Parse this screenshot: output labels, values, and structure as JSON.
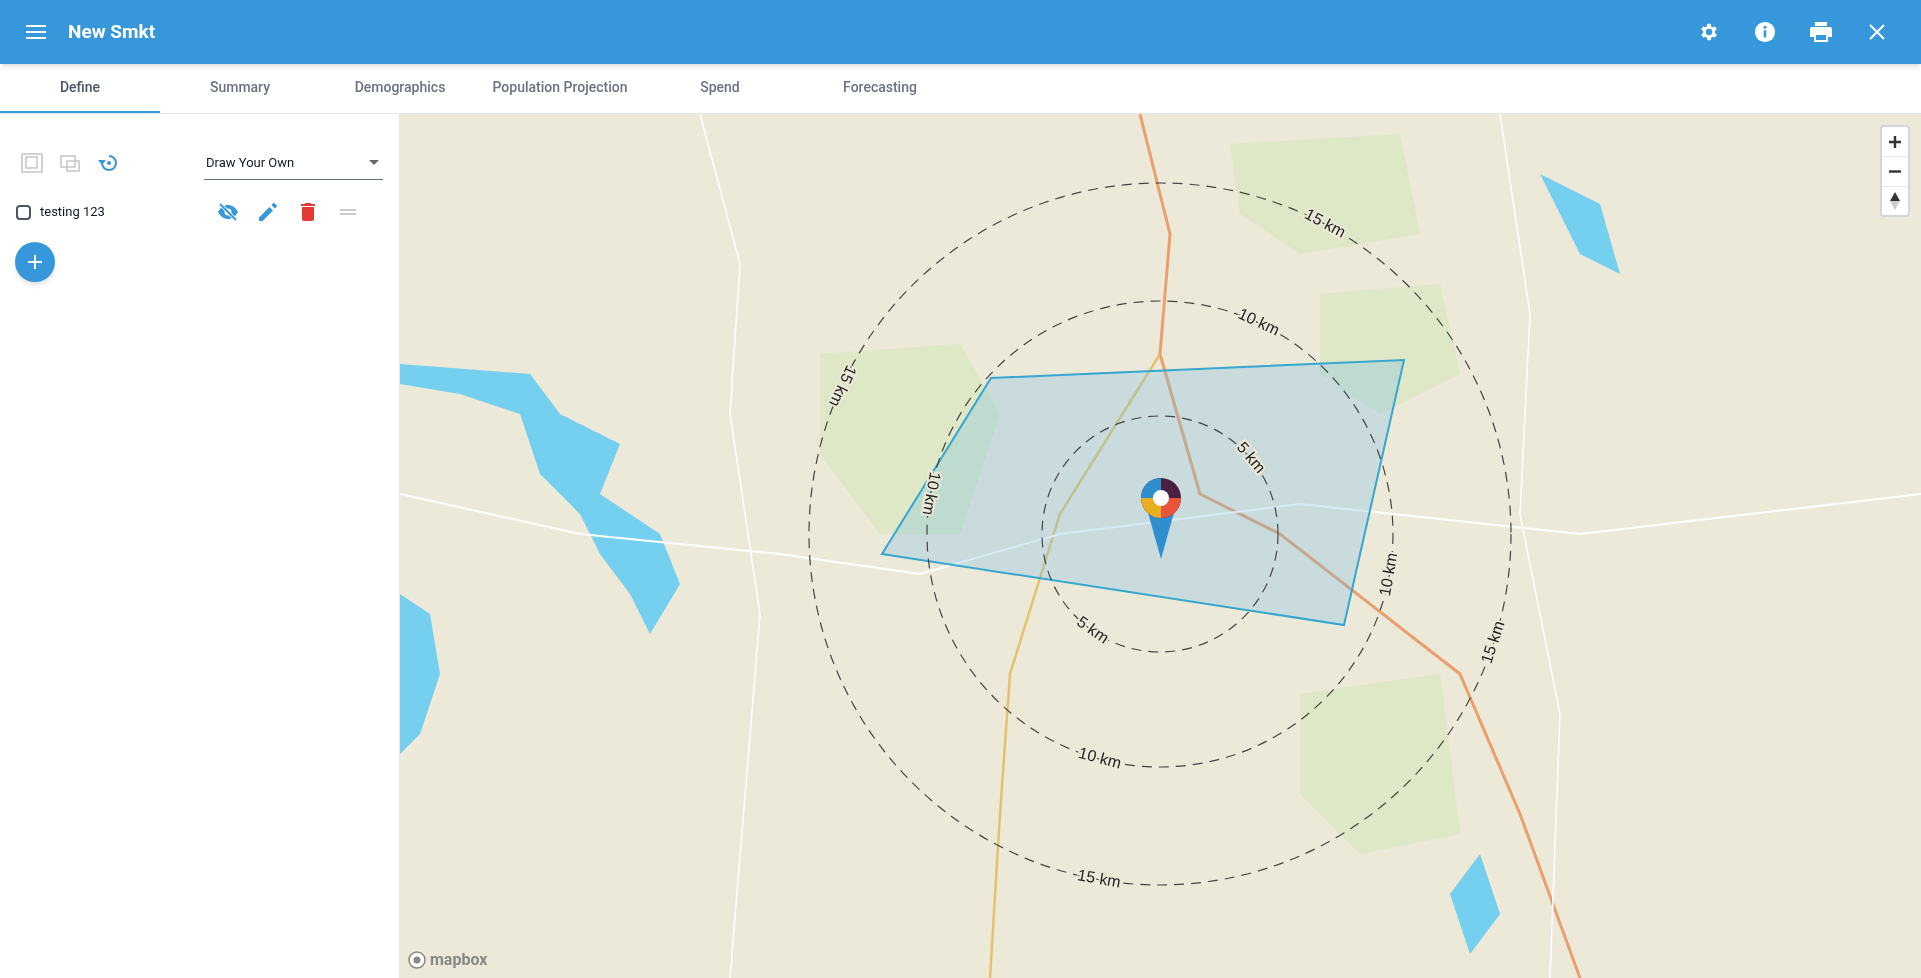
{
  "app_bar": {
    "title": "New Smkt"
  },
  "tabs": [
    {
      "label": "Define",
      "selected": true
    },
    {
      "label": "Summary",
      "selected": false
    },
    {
      "label": "Demographics",
      "selected": false
    },
    {
      "label": "Population Projection",
      "selected": false
    },
    {
      "label": "Spend",
      "selected": false
    },
    {
      "label": "Forecasting",
      "selected": false
    }
  ],
  "panel": {
    "tools": [
      {
        "kind": "select-area",
        "disabled": true
      },
      {
        "kind": "move-area",
        "disabled": true
      },
      {
        "kind": "reset",
        "disabled": false
      }
    ],
    "mode_select": {
      "value": "Draw Your Own"
    },
    "layers": [
      {
        "name": "testing 123",
        "checked": false,
        "visible": false
      }
    ]
  },
  "map": {
    "rings": [
      {
        "labels": [
          "5 km",
          "5 km"
        ]
      },
      {
        "labels": [
          "10 km",
          "10 km",
          "10 km",
          "10 km"
        ]
      },
      {
        "labels": [
          "15 km",
          "15 km",
          "15 km",
          "15 km"
        ]
      }
    ],
    "attribution": "mapbox"
  }
}
